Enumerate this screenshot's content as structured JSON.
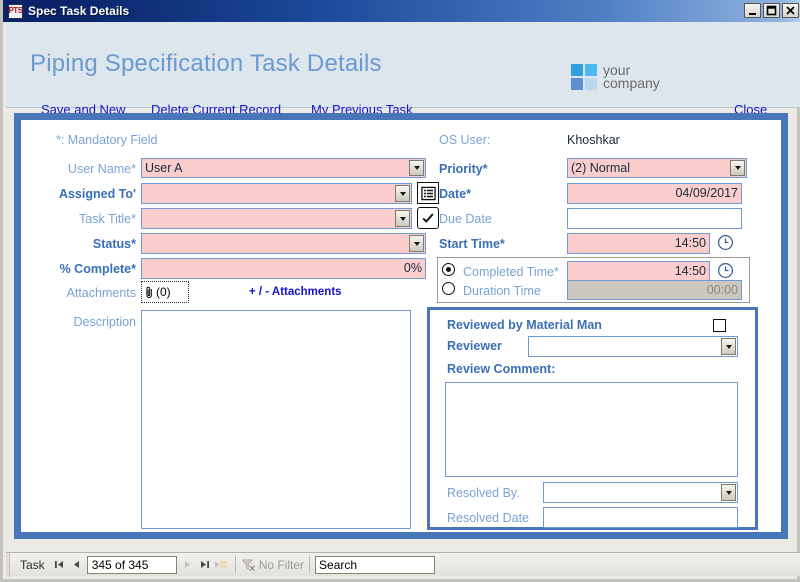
{
  "window": {
    "title": "Spec Task Details",
    "icon": "pts-app-icon",
    "buttons": [
      {
        "name": "minimize",
        "glyph": "minimize-icon"
      },
      {
        "name": "maximize",
        "glyph": "maximize-icon"
      },
      {
        "name": "close",
        "glyph": "close-icon"
      }
    ]
  },
  "header": {
    "title": "Piping Specification Task Details",
    "logo": {
      "line1": "your",
      "line2": "company"
    }
  },
  "toolbar": {
    "save_and_new": "Save and New",
    "delete_current_record": "Delete Current Record",
    "my_previous_task": "My Previous Task",
    "close": "Close"
  },
  "form": {
    "mandatory_note": "*: Mandatory Field",
    "left": {
      "user_name": {
        "label": "User Name*",
        "value": "User A"
      },
      "assigned_to": {
        "label": "Assigned To'",
        "value": ""
      },
      "task_title": {
        "label": "Task Title*",
        "value": ""
      },
      "status": {
        "label": "Status*",
        "value": ""
      },
      "percent_complete": {
        "label": "% Complete*",
        "value": "0%"
      },
      "attachments": {
        "label": "Attachments",
        "value": "(0)",
        "action": "+ / -  Attachments"
      },
      "description": {
        "label": "Description",
        "value": ""
      }
    },
    "right": {
      "os_user": {
        "label": "OS User:",
        "value": "Khoshkar"
      },
      "priority": {
        "label": "Priority*",
        "value": "(2) Normal"
      },
      "date": {
        "label": "Date*",
        "value": "04/09/2017"
      },
      "due_date": {
        "label": "Due Date",
        "value": ""
      },
      "start_time": {
        "label": "Start Time*",
        "value": "14:50"
      },
      "completed_time": {
        "label": "Completed Time*",
        "value": "14:50",
        "selected": true
      },
      "duration_time": {
        "label": "Duration Time",
        "value": "00:00",
        "selected": false
      }
    },
    "review": {
      "reviewed_by_material_man": {
        "label": "Reviewed by Material Man",
        "checked": false
      },
      "reviewer": {
        "label": "Reviewer",
        "value": ""
      },
      "review_comment": {
        "label": "Review Comment:",
        "value": ""
      },
      "resolved_by": {
        "label": "Resolved By.",
        "value": ""
      },
      "resolved_date": {
        "label": "Resolved Date",
        "value": ""
      }
    }
  },
  "statusbar": {
    "object_label": "Task",
    "record_position": "345 of 345",
    "filter_label": "No Filter",
    "search_value": "Search",
    "search_placeholder": "Search"
  },
  "colors": {
    "accent_blue": "#4876b8",
    "mandatory_pink": "#fbcdcd",
    "header_band": "#dce6ec",
    "link_blue": "#1414d0",
    "label_blue": "#7aa3d4",
    "label_bold_blue": "#3a6fb5",
    "disabled_gray": "#ccc8bf"
  }
}
